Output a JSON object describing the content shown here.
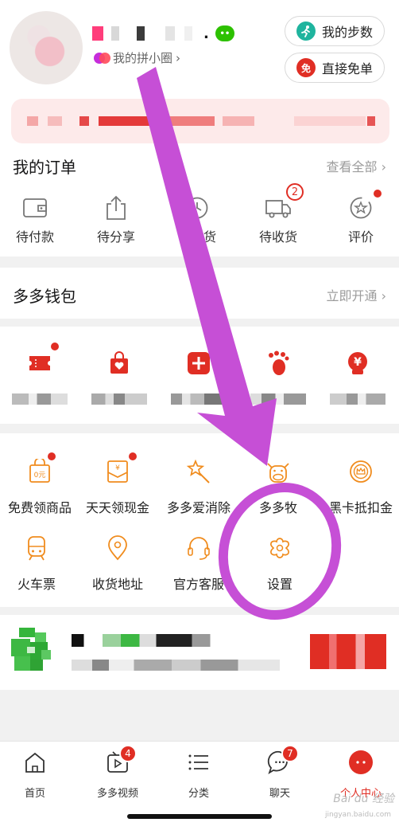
{
  "header": {
    "name_suffix": ".",
    "circle_link": "我的拼小圈",
    "circle_chevron": "›",
    "steps_button": "我的步数",
    "free_button": "直接免单",
    "free_icon_text": "免",
    "wechat_icon_text": "••"
  },
  "orders": {
    "title": "我的订单",
    "more": "查看全部 ›",
    "items": [
      {
        "label": "待付款"
      },
      {
        "label": "待分享"
      },
      {
        "label": "待发货"
      },
      {
        "label": "待收货",
        "badge": "2"
      },
      {
        "label": "评价"
      }
    ]
  },
  "wallet": {
    "title": "多多钱包",
    "more": "立即开通 ›"
  },
  "wallet_tiles": {
    "icons": [
      "coupon-icon",
      "bag-icon",
      "plus-icon",
      "foot-icon",
      "yuan-icon"
    ],
    "yuan_text": "¥"
  },
  "tools": {
    "items": [
      {
        "label": "免费领商品",
        "icon_text": "0元"
      },
      {
        "label": "天天领现金",
        "icon_text": "¥"
      },
      {
        "label": "多多爱消除"
      },
      {
        "label": "多多牧"
      },
      {
        "label": "黑卡抵扣金"
      },
      {
        "label": "火车票"
      },
      {
        "label": "收货地址"
      },
      {
        "label": "官方客服"
      },
      {
        "label": "设置"
      }
    ]
  },
  "nav": {
    "items": [
      {
        "label": "首页"
      },
      {
        "label": "多多视频",
        "badge": "4"
      },
      {
        "label": "分类"
      },
      {
        "label": "聊天",
        "badge": "7"
      },
      {
        "label": "个人中心"
      }
    ],
    "chat_dots": "···"
  },
  "watermark": {
    "brand": "Bai du 经验",
    "domain": "jingyan.baidu.com"
  },
  "colors": {
    "brand_red": "#e02e24",
    "annotation_purple": "#c64fd6",
    "wechat_green": "#2dc100"
  }
}
